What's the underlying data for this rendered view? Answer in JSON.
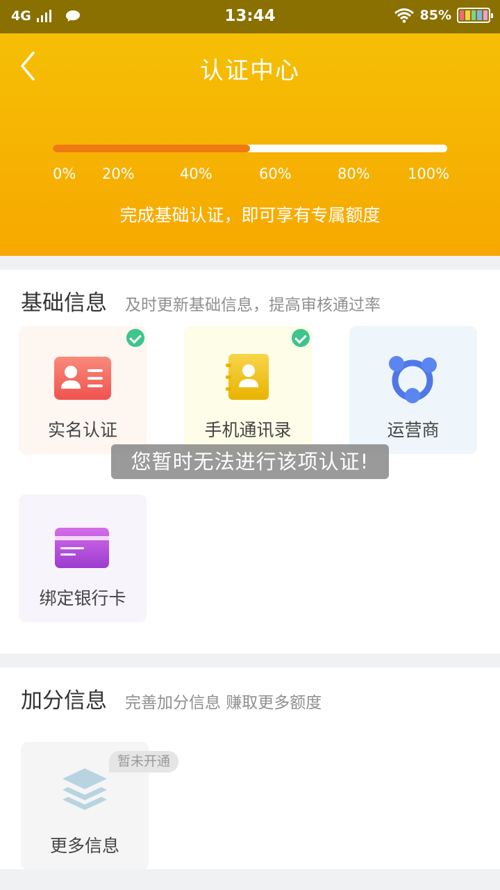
{
  "status_bar": {
    "network": "4G",
    "time": "13:44",
    "battery_percent": "85%"
  },
  "header": {
    "title": "认证中心",
    "progress_fraction": 0.5,
    "tick_labels": [
      "0%",
      "20%",
      "40%",
      "60%",
      "80%",
      "100%"
    ],
    "hint": "完成基础认证，即可享有专属额度"
  },
  "basic_section": {
    "title": "基础信息",
    "subtitle": "及时更新基础信息，提高审核通过率",
    "items": [
      {
        "label": "实名认证",
        "icon": "id-card-icon",
        "verified": true
      },
      {
        "label": "手机通讯录",
        "icon": "contacts-book-icon",
        "verified": true
      },
      {
        "label": "运营商",
        "icon": "carrier-network-icon",
        "verified": false
      },
      {
        "label": "绑定银行卡",
        "icon": "bank-card-icon",
        "verified": false
      }
    ]
  },
  "bonus_section": {
    "title": "加分信息",
    "subtitle": "完善加分信息 赚取更多额度",
    "items": [
      {
        "label": "更多信息",
        "icon": "layers-icon",
        "tag": "暂未开通"
      }
    ]
  },
  "toast": "您暂时无法进行该项认证!",
  "colors": {
    "header_top": "#f5bf05",
    "header_bottom": "#f7a800",
    "progress_fill": "#f07a12",
    "check": "#3ec58b"
  }
}
